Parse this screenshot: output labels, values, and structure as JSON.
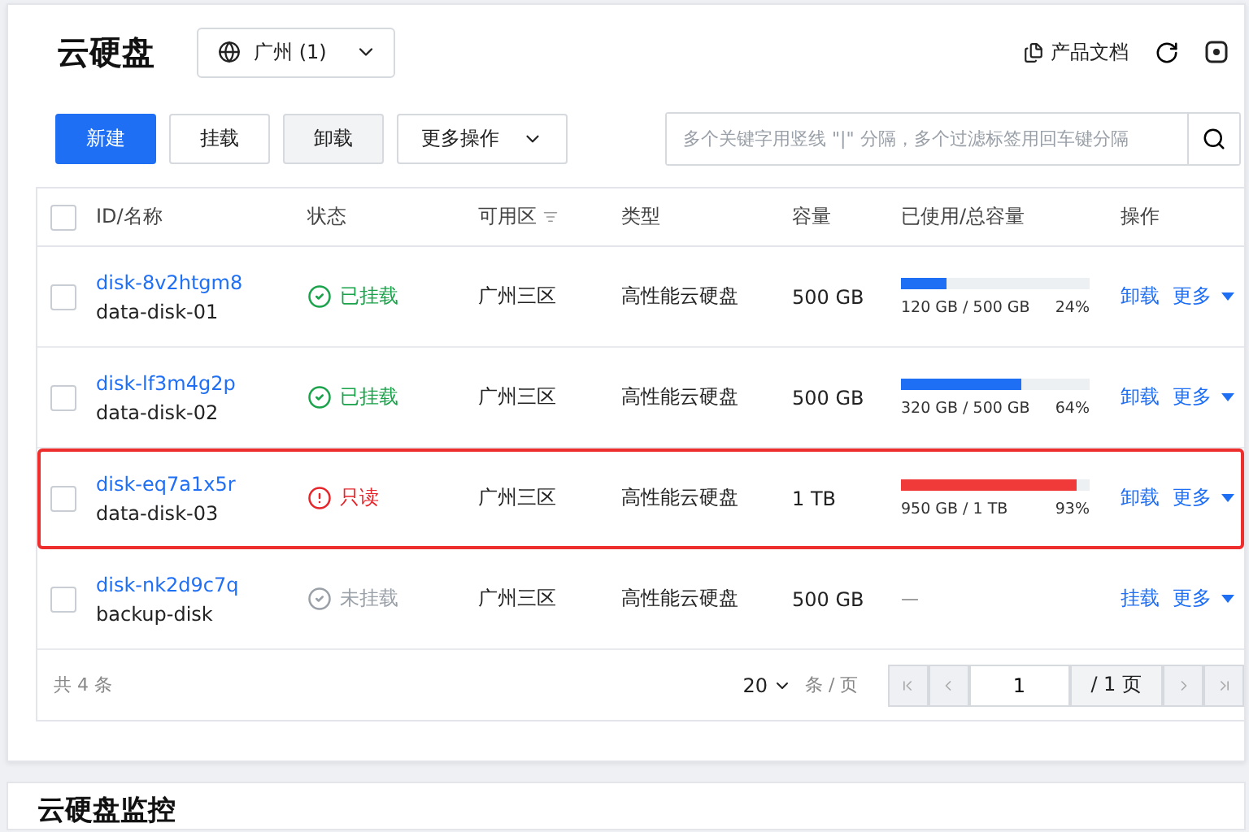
{
  "header": {
    "title": "云硬盘",
    "region": "广州 (1)",
    "docs_link": "产品文档"
  },
  "toolbar": {
    "buttons": [
      {
        "label": "新建",
        "kind": "primary"
      },
      {
        "label": "挂载",
        "kind": "default"
      },
      {
        "label": "卸载",
        "kind": "muted"
      },
      {
        "label": "更多操作",
        "kind": "dropdown"
      }
    ],
    "search": {
      "placeholder": "多个关键字用竖线 \"|\" 分隔，多个过滤标签用回车键分隔"
    }
  },
  "table": {
    "select_all": {
      "checked": false
    },
    "columns": [
      "ID/名称",
      "状态",
      "可用区",
      "类型",
      "容量",
      "已使用/总容量",
      "操作"
    ],
    "rows": [
      {
        "checked": false,
        "highlighted": false,
        "id": "disk-8v2htgm8",
        "name": "data-disk-01",
        "status": {
          "kind": "mounted",
          "label": "已挂载"
        },
        "zone": "广州三区",
        "type": "高性能云硬盘",
        "capacity": "500 GB",
        "usage": {
          "level": 0.24,
          "color": "#1f6ff5",
          "text": "120 GB / 500 GB",
          "percent": "24%"
        },
        "actions": [
          "卸载",
          "更多"
        ]
      },
      {
        "checked": false,
        "highlighted": false,
        "id": "disk-lf3m4g2p",
        "name": "data-disk-02",
        "status": {
          "kind": "mounted",
          "label": "已挂载"
        },
        "zone": "广州三区",
        "type": "高性能云硬盘",
        "capacity": "500 GB",
        "usage": {
          "level": 0.64,
          "color": "#1f6ff5",
          "text": "320 GB / 500 GB",
          "percent": "64%"
        },
        "actions": [
          "卸载",
          "更多"
        ]
      },
      {
        "checked": false,
        "highlighted": true,
        "id": "disk-eq7a1x5r",
        "name": "data-disk-03",
        "status": {
          "kind": "readonly",
          "label": "只读"
        },
        "zone": "广州三区",
        "type": "高性能云硬盘",
        "capacity": "1 TB",
        "usage": {
          "level": 0.93,
          "color": "#f03a3a",
          "text": "950 GB / 1 TB",
          "percent": "93%"
        },
        "actions": [
          "卸载",
          "更多"
        ]
      },
      {
        "checked": false,
        "highlighted": false,
        "id": "disk-nk2d9c7q",
        "name": "backup-disk",
        "status": {
          "kind": "unmounted",
          "label": "未挂载"
        },
        "zone": "广州三区",
        "type": "高性能云硬盘",
        "capacity": "500 GB",
        "usage": {
          "empty": "—"
        },
        "actions": [
          "挂载",
          "更多"
        ]
      }
    ]
  },
  "pagination": {
    "total": "共 4 条",
    "page_size": "20",
    "page_size_unit": "条 / 页",
    "page": "1",
    "page_count": "/ 1 页"
  },
  "monitor": {
    "title": "云硬盘监控"
  }
}
